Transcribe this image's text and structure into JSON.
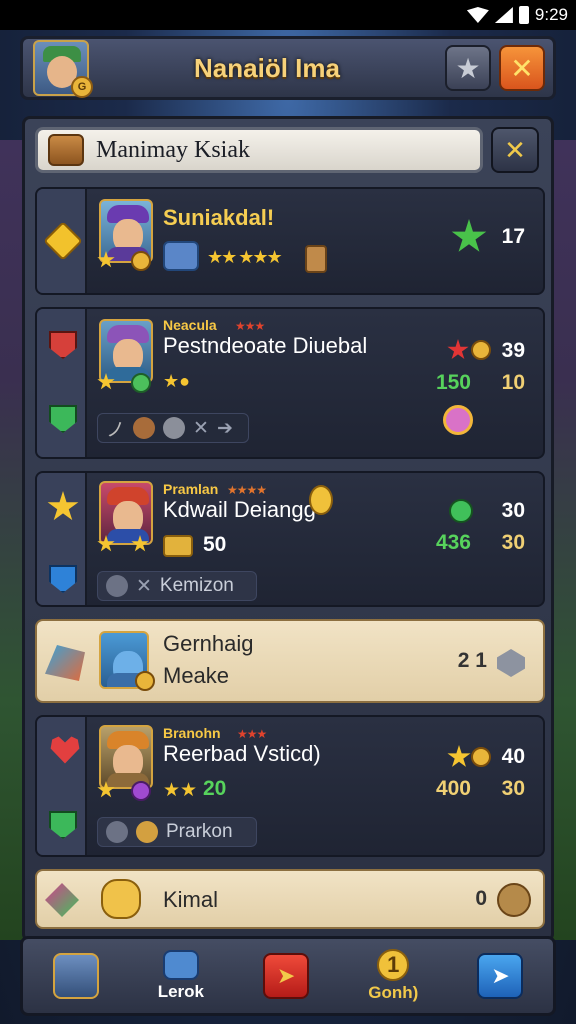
{
  "status_bar": {
    "time": "9:29"
  },
  "header": {
    "title": "Nanaiöl Ima",
    "avatar_badge": "G"
  },
  "search": {
    "value": "Manimay Ksiak"
  },
  "cards": [
    {
      "name": "Suniakdal!",
      "stat_a": "17"
    },
    {
      "subname": "Neacula",
      "name": "Pestndeoate Diuebal",
      "stat_a": "39",
      "stat_b1": "150",
      "stat_b2": "10"
    },
    {
      "subname": "Pramlan",
      "name": "Kdwail Deiangg",
      "level": "50",
      "pill": "Kemizon",
      "stat_a": "30",
      "stat_b1": "436",
      "stat_b2": "30"
    },
    {
      "name": "Gernhaig",
      "sub": "Meake",
      "count": "2 1"
    },
    {
      "subname": "Branohn",
      "name": "Reerbad Vsticd)",
      "level": "20",
      "pill": "Prarkon",
      "stat_a": "40",
      "stat_b1": "400",
      "stat_b2": "30"
    },
    {
      "name": "Kimal",
      "count": "0"
    }
  ],
  "bottom_nav": [
    {
      "label": ""
    },
    {
      "label": "Lerok"
    },
    {
      "label": ""
    },
    {
      "label": "Gonh)"
    },
    {
      "label": ""
    }
  ],
  "icons": {
    "header_star": "★",
    "header_close": "✕",
    "panel_close": "✕",
    "nav_play": "➤",
    "nav_coin": "1",
    "nav_share": "➤"
  }
}
